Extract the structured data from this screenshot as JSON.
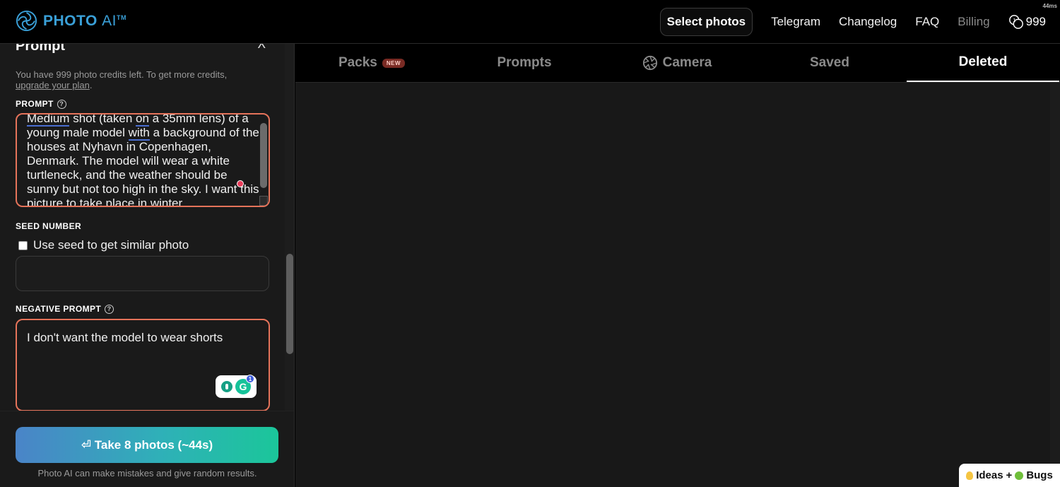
{
  "app": {
    "logo_text": "PHOTO",
    "logo_ai": "AI",
    "logo_tm": "TM",
    "timing": "44ms"
  },
  "nav": {
    "select_photos": "Select photos",
    "telegram": "Telegram",
    "changelog": "Changelog",
    "faq": "FAQ",
    "billing": "Billing",
    "credits": "999"
  },
  "panel": {
    "title": "Prompt",
    "credits_note": "You have 999 photo credits left. To get more credits,",
    "upgrade_link": "upgrade your plan",
    "upgrade_suffix": ".",
    "prompt_label": "PROMPT",
    "prompt_word1": "Medium",
    "prompt_seg1": " shot (taken ",
    "prompt_word2": "on",
    "prompt_seg2": " a 35mm lens) of a young male model ",
    "prompt_word3": "with",
    "prompt_seg3": " a background of the houses at Nyhavn in Copenhagen, Denmark. The model will wear a white turtleneck, and the weather should be sunny but not too high in the sky. I want this picture to take place in winter.",
    "seed_label": "SEED NUMBER",
    "seed_checkbox_label": "Use seed to get similar photo",
    "seed_value": "",
    "negative_label": "NEGATIVE PROMPT",
    "negative_text": "I don't want the model to wear shorts",
    "grammarly_letter": "G",
    "grammarly_count": "1",
    "take_button": "⏎ Take 8 photos (~44s)",
    "disclaimer": "Photo AI can make mistakes and give random results."
  },
  "tabs": {
    "packs": "Packs",
    "packs_badge": "NEW",
    "prompts": "Prompts",
    "camera": "Camera",
    "saved": "Saved",
    "deleted": "Deleted",
    "active": "Deleted"
  },
  "feedback": {
    "ideas": "Ideas",
    "plus": "+",
    "bugs": "Bugs"
  },
  "colors": {
    "brand": "#3aa0d8",
    "textbox_border": "#e5735a",
    "button_gradient_start": "#4a84c8",
    "button_gradient_end": "#1bc69a",
    "new_badge": "#7a2b24"
  }
}
